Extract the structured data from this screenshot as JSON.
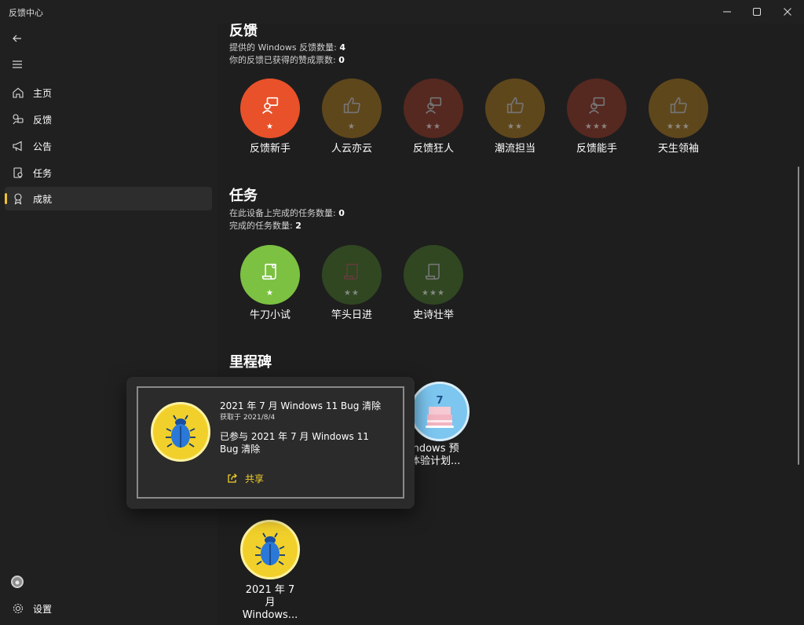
{
  "window": {
    "title": "反馈中心",
    "buttons": {
      "minimize": "minimize-icon",
      "maximize": "maximize-icon",
      "close": "close-icon"
    }
  },
  "sidebar": {
    "back_icon": "back-arrow-icon",
    "menu_icon": "hamburger-icon",
    "items": [
      {
        "label": "主页",
        "icon": "home-icon",
        "active": false
      },
      {
        "label": "反馈",
        "icon": "feedback-icon",
        "active": false
      },
      {
        "label": "公告",
        "icon": "megaphone-icon",
        "active": false
      },
      {
        "label": "任务",
        "icon": "quest-icon",
        "active": false
      },
      {
        "label": "成就",
        "icon": "achievement-icon",
        "active": true
      }
    ],
    "settings_label": "设置",
    "accent_color": "#f1c232"
  },
  "feedback_section": {
    "title": "反馈",
    "line1_prefix": "提供的 Windows 反馈数量: ",
    "line1_value": "4",
    "line2_prefix": "你的反馈已获得的赞成票数: ",
    "line2_value": "0",
    "badges": [
      {
        "label": "反馈新手",
        "stars": "★",
        "color": "#e8512a",
        "earned": true
      },
      {
        "label": "人云亦云",
        "stars": "★",
        "color": "#c98a1b",
        "earned": false
      },
      {
        "label": "反馈狂人",
        "stars": "★★",
        "color": "#b03a25",
        "earned": false
      },
      {
        "label": "潮流担当",
        "stars": "★★",
        "color": "#c98a1b",
        "earned": false
      },
      {
        "label": "反馈能手",
        "stars": "★★★",
        "color": "#b03a25",
        "earned": false
      },
      {
        "label": "天生领袖",
        "stars": "★★★",
        "color": "#c98a1b",
        "earned": false
      }
    ]
  },
  "quest_section": {
    "title": "任务",
    "line1_prefix": "在此设备上完成的任务数量: ",
    "line1_value": "0",
    "line2_prefix": "完成的任务数量: ",
    "line2_value": "2",
    "badges": [
      {
        "label": "牛刀小试",
        "stars": "★",
        "color": "#7cc142",
        "earned": true
      },
      {
        "label": "竿头日进",
        "stars": "★★",
        "color": "#4f8a2a",
        "earned": false
      },
      {
        "label": "史诗壮举",
        "stars": "★★★",
        "color": "#4f8a2a",
        "earned": false
      }
    ]
  },
  "milestone_section": {
    "title": "里程碑",
    "bug_badge_label_line1": "2021 年 7 月",
    "bug_badge_label_line2": "Windows...",
    "cake_badge_label_line1": "indows 预",
    "cake_badge_label_line2": "体验计划...",
    "cake_number": "7"
  },
  "popup": {
    "title": "2021 年 7 月 Windows 11 Bug 清除",
    "date": "获取于 2021/8/4",
    "description": "已参与 2021 年 7 月 Windows 11 Bug 清除",
    "share_label": "共享",
    "share_color": "#f2d02b"
  }
}
